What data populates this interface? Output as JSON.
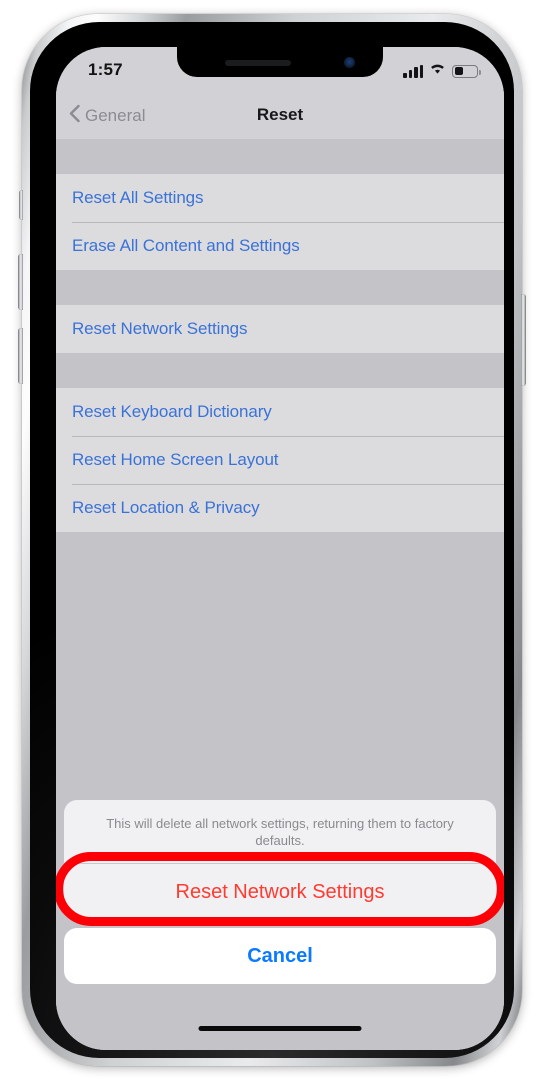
{
  "status_bar": {
    "time": "1:57",
    "signal_icon": "cellular-signal-icon",
    "signal_bars": 4,
    "wifi_icon": "wifi-icon",
    "battery_icon": "battery-icon",
    "battery_level_percent": 35
  },
  "nav_bar": {
    "back_icon": "chevron-left-icon",
    "back_label": "General",
    "title": "Reset"
  },
  "settings_groups": [
    {
      "items": [
        {
          "label": "Reset All Settings"
        },
        {
          "label": "Erase All Content and Settings"
        }
      ]
    },
    {
      "items": [
        {
          "label": "Reset Network Settings"
        }
      ]
    },
    {
      "items": [
        {
          "label": "Reset Keyboard Dictionary"
        },
        {
          "label": "Reset Home Screen Layout"
        },
        {
          "label": "Reset Location & Privacy"
        }
      ]
    }
  ],
  "action_sheet": {
    "message": "This will delete all network settings, returning them to factory defaults.",
    "destructive_label": "Reset Network Settings",
    "cancel_label": "Cancel"
  },
  "annotation": {
    "shape": "oval-highlight",
    "color": "#fb0007",
    "target": "Reset Network Settings"
  },
  "colors": {
    "link_blue": "#3a72d8",
    "cancel_blue": "#0a7aff",
    "destructive_red": "#ff3b30",
    "cell_background": "#dcdcde",
    "screen_background": "#c3c3c8",
    "chrome_background": "#d2d2d6"
  },
  "device": {
    "home_indicator": "home-indicator-bar",
    "notch": "notch-cutout"
  }
}
